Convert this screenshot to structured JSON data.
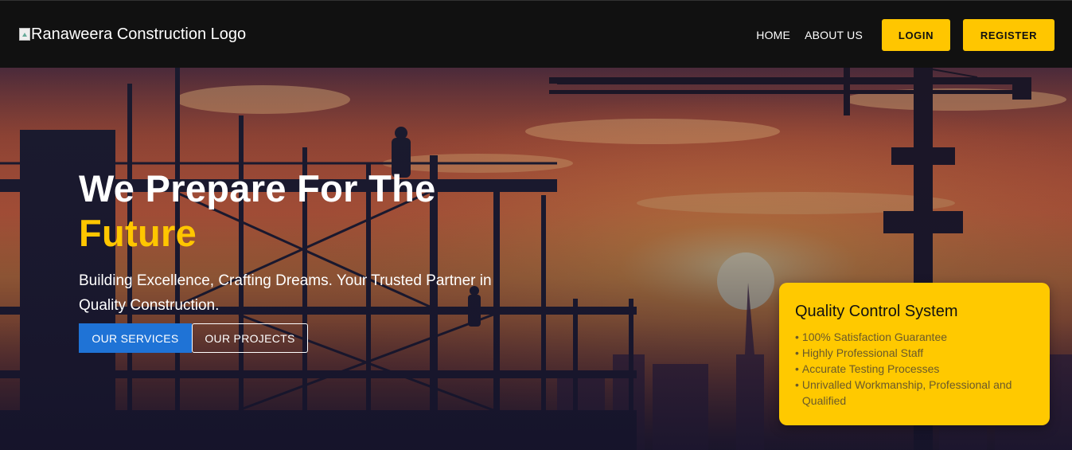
{
  "header": {
    "logo_alt": "Ranaweera Construction Logo",
    "nav": [
      {
        "label": "HOME"
      },
      {
        "label": "ABOUT US"
      }
    ],
    "login_label": "LOGIN",
    "register_label": "REGISTER"
  },
  "hero": {
    "headline_line1": "We Prepare For The",
    "headline_accent": "Future",
    "tagline": "Building Excellence, Crafting Dreams. Your Trusted Partner in Quality Construction.",
    "services_label": "OUR SERVICES",
    "projects_label": "OUR PROJECTS"
  },
  "quality_card": {
    "title": "Quality Control System",
    "items": [
      "100% Satisfaction Guarantee",
      "Highly Professional Staff",
      "Accurate Testing Processes",
      "Unrivalled Workmanship, Professional and Qualified"
    ],
    "bullet": "•"
  },
  "colors": {
    "header_bg": "#111111",
    "accent_yellow": "#ffc600",
    "services_blue": "#1f73d6",
    "card_yellow": "#ffc900"
  }
}
